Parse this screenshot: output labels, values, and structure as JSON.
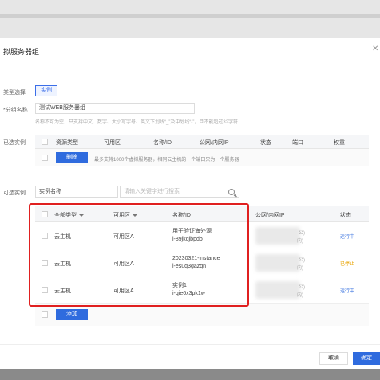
{
  "dialog": {
    "title": "拟服务器组",
    "close_icon": "close-icon"
  },
  "form": {
    "type_label": "类型选择",
    "type_value": "实例",
    "name_label": "*分组名称",
    "name_value": "测试WEB服务器组",
    "name_hint": "名称不可为空，只支持中文、数字、大小写字母、英文下划线“_”及中划线“-”，且不能超过32字符",
    "selected_label": "已选实例",
    "available_label": "可选实例"
  },
  "selected_table": {
    "headers": [
      "资源类型",
      "可用区",
      "名称/ID",
      "公网/内网IP",
      "状态",
      "端口",
      "权重"
    ],
    "delete_label": "删除",
    "note": "最多支持1000个虚拟服务器，相同云主机的一个端口只为一个服务器"
  },
  "filter": {
    "field_value": "实例名称",
    "search_placeholder": "请输入关键字进行搜索"
  },
  "available_table": {
    "headers": {
      "type": "全部类型",
      "zone": "可用区",
      "name": "名称/ID",
      "ip": "公网/内网IP",
      "status": "状态"
    },
    "rows": [
      {
        "type": "云主机",
        "zone": "可用区A",
        "name": "用于验证海外源",
        "id": "i-89jkqjbpdo",
        "ip_a": "公)",
        "ip_b": "内)",
        "status": "运行中",
        "status_color": "#2f6bde"
      },
      {
        "type": "云主机",
        "zone": "可用区A",
        "name": "20230321-instance",
        "id": "i-esuq3gazqn",
        "ip_a": "公)",
        "ip_b": "内)",
        "status": "已停止",
        "status_color": "#e8a300"
      },
      {
        "type": "云主机",
        "zone": "可用区A",
        "name": "实例1",
        "id": "i-qie6x3pk1w",
        "ip_a": "公)",
        "ip_b": "内)",
        "status": "运行中",
        "status_color": "#2f6bde"
      }
    ],
    "add_label": "添加"
  },
  "footer": {
    "cancel_label": "取消",
    "confirm_label": "确定"
  },
  "colors": {
    "accent": "#2f6bde",
    "highlight": "#e02020"
  }
}
